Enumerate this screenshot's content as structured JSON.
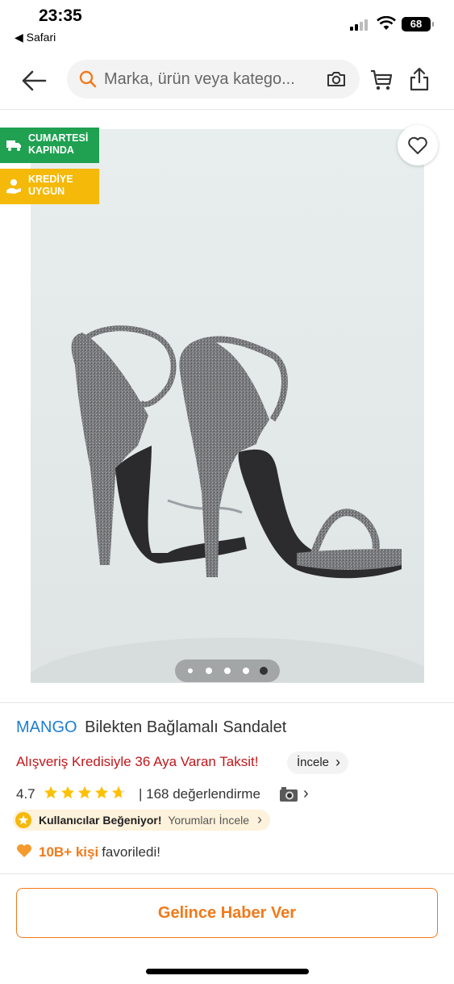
{
  "status_bar": {
    "time": "23:35",
    "back_app": "◀ Safari",
    "battery": "68"
  },
  "nav": {
    "search_placeholder": "Marka, ürün veya katego..."
  },
  "badges": {
    "delivery": "CUMARTESİ\nKAPINDA",
    "credit": "KREDİYE\nUYGUN",
    "delivery_color": "#1fa151",
    "credit_color": "#f5b90a"
  },
  "gallery": {
    "total_images": 5,
    "active_index": 5
  },
  "product": {
    "brand": "MANGO",
    "name": "Bilekten Bağlamalı Sandalet",
    "promo": "Alışveriş Kredisiyle 36 Aya Varan Taksit!",
    "promo_link": "İncele",
    "rating": "4.7",
    "rating_value": 4.7,
    "review_count": "| 168 değerlendirme",
    "liked_label": "Kullanıcılar Beğeniyor!",
    "liked_link": "Yorumları İncele",
    "fav_count": "10B+ kişi",
    "fav_text": "favoriledi!"
  },
  "cta": {
    "label": "Gelince Haber Ver"
  },
  "colors": {
    "brand_blue": "#1f7ed3",
    "accent_orange": "#f27a1a",
    "promo_red": "#c0171b"
  }
}
